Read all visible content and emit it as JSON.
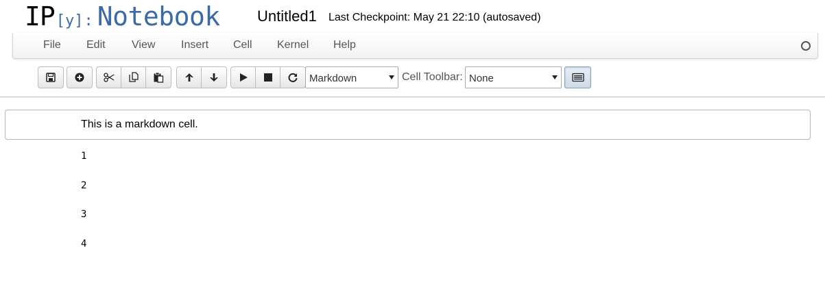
{
  "header": {
    "logo": {
      "ip": "IP",
      "y": "[y]",
      "colon": ":",
      "notebook": "Notebook"
    },
    "notebook_name": "Untitled1",
    "checkpoint": "Last Checkpoint: May 21 22:10 (autosaved)"
  },
  "menubar": {
    "items": [
      "File",
      "Edit",
      "View",
      "Insert",
      "Cell",
      "Kernel",
      "Help"
    ]
  },
  "toolbar": {
    "buttons": [
      "save-icon",
      "insert-cell-below-icon",
      "cut-icon",
      "copy-icon",
      "paste-icon",
      "move-up-icon",
      "move-down-icon",
      "run-icon",
      "stop-icon",
      "restart-icon"
    ],
    "cell_type": "Markdown",
    "celltoolbar_label": "Cell Toolbar:",
    "celltoolbar_value": "None",
    "toggle_icon": "keyboard-icon"
  },
  "notebook": {
    "markdown_cell": "This is a markdown cell.",
    "output_lines": [
      "1",
      "2",
      "3",
      "4"
    ]
  },
  "colors": {
    "logo_blue": "#3c6aa5",
    "menu_text": "#555555"
  }
}
